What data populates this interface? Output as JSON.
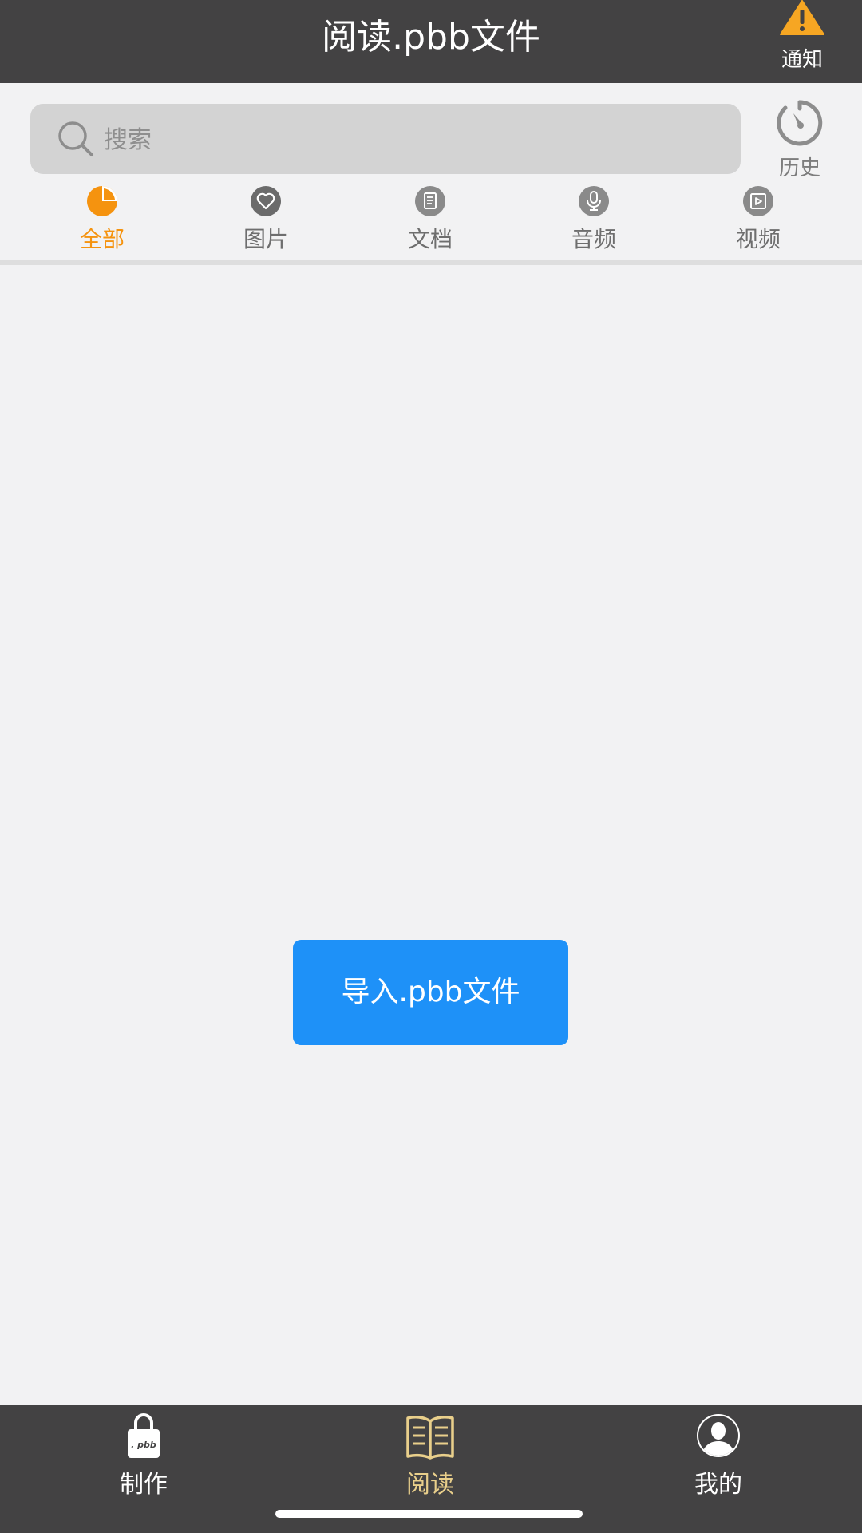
{
  "header": {
    "title": "阅读.pbb文件",
    "notify_label": "通知"
  },
  "search": {
    "placeholder": "搜索"
  },
  "history": {
    "label": "历史"
  },
  "tabs": [
    {
      "label": "全部",
      "icon": "pie-chart-icon",
      "active": true
    },
    {
      "label": "图片",
      "icon": "heart-icon",
      "active": false
    },
    {
      "label": "文档",
      "icon": "document-icon",
      "active": false
    },
    {
      "label": "音频",
      "icon": "microphone-icon",
      "active": false
    },
    {
      "label": "视频",
      "icon": "video-icon",
      "active": false
    }
  ],
  "main": {
    "import_label": "导入.pbb文件"
  },
  "bottom_nav": [
    {
      "label": "制作",
      "icon": "lock-pbb-icon",
      "badge_text": ". pbb",
      "active": false
    },
    {
      "label": "阅读",
      "icon": "open-book-icon",
      "active": true
    },
    {
      "label": "我的",
      "icon": "user-avatar-icon",
      "active": false
    }
  ],
  "colors": {
    "header_bg": "#434243",
    "accent_orange": "#f5930f",
    "button_blue": "#1e91f8",
    "active_bottom": "#e9cf8b",
    "warning_yellow": "#f6a623"
  }
}
